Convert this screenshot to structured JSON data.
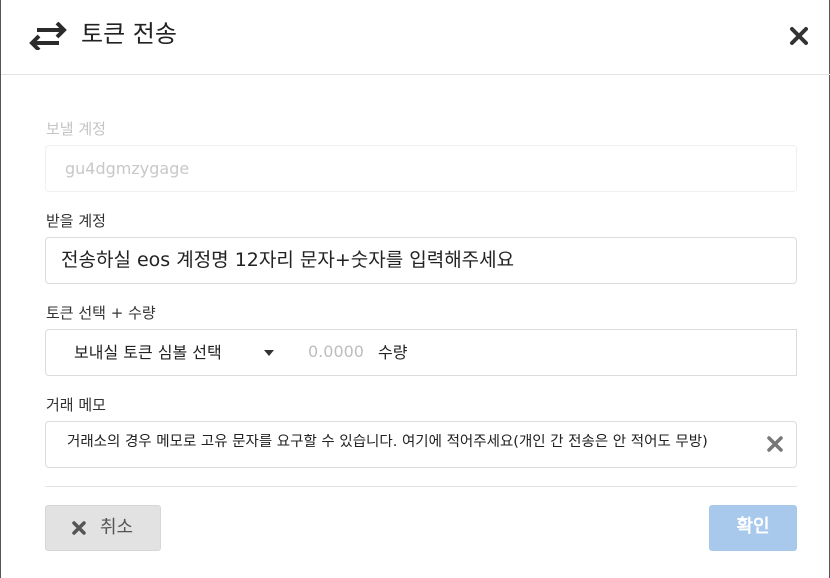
{
  "header": {
    "title": "토큰 전송",
    "icon": "transfer-arrows-icon",
    "close_icon": "close-icon"
  },
  "from_account": {
    "label": "보낼 계정",
    "value": "gu4dgmzygage"
  },
  "to_account": {
    "label": "받을 계정",
    "placeholder": "전송하실 eos 계정명 12자리 문자+숫자를 입력해주세요"
  },
  "token": {
    "label": "토큰 선택 + 수량",
    "select_label": "보내실 토큰 심볼 선택",
    "amount_placeholder": "0.0000",
    "amount_unit": "수량"
  },
  "memo": {
    "label": "거래 메모",
    "placeholder": "거래소의 경우 메모로 고유 문자를 요구할 수 있습니다. 여기에 적어주세요(개인 간 전송은 안 적어도 무방)"
  },
  "buttons": {
    "cancel": "취소",
    "confirm": "확인"
  },
  "colors": {
    "confirm_bg": "#a8c9ec",
    "cancel_bg": "#e2e2e2"
  }
}
